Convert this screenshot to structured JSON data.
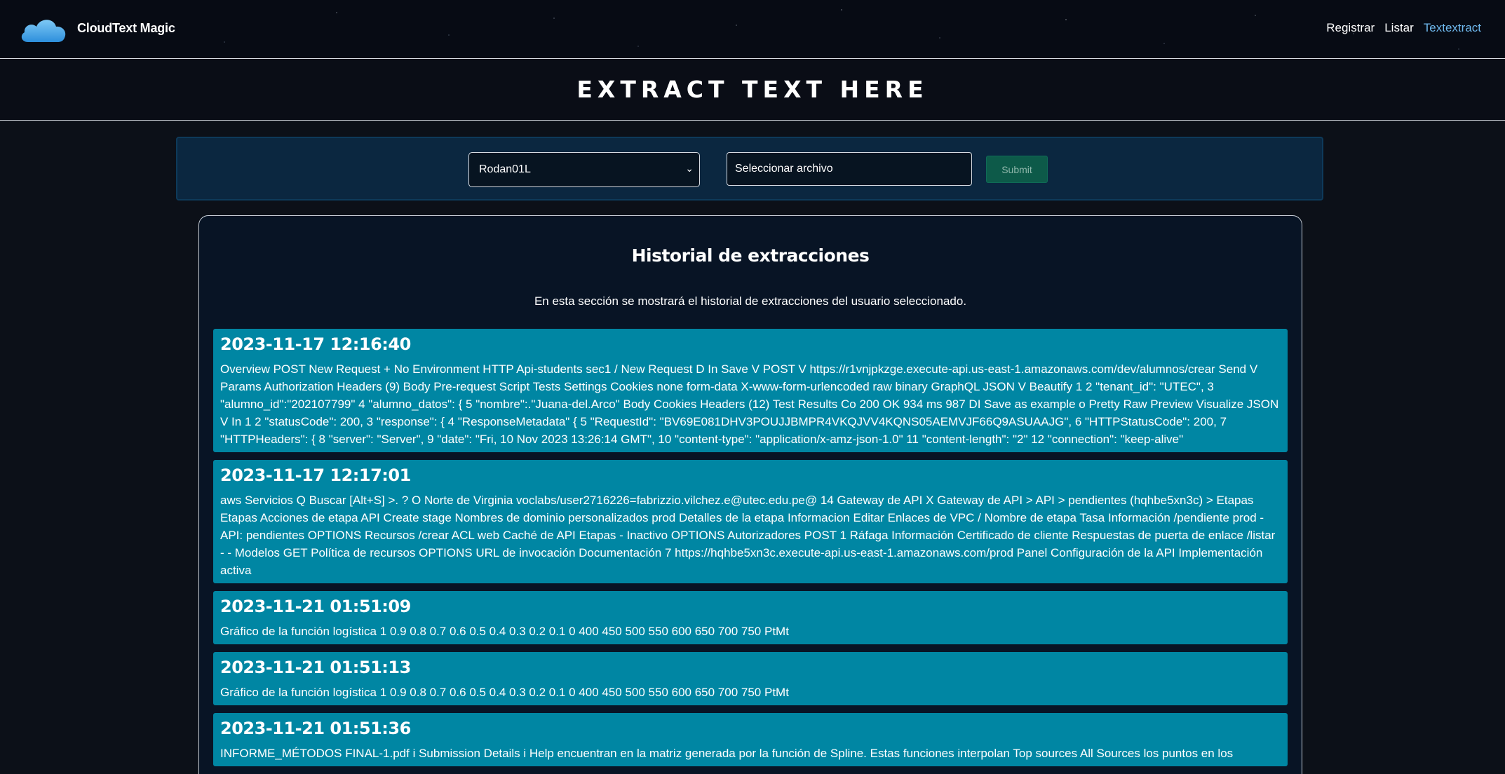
{
  "header": {
    "brand": "CloudText Magic",
    "nav": [
      {
        "label": "Registrar"
      },
      {
        "label": "Listar"
      },
      {
        "label": "Textextract"
      }
    ]
  },
  "banner": {
    "title": "EXTRACT TEXT HERE"
  },
  "form": {
    "user_select_value": "Rodan01L",
    "file_label": "Seleccionar archivo",
    "submit_label": "Submit"
  },
  "history": {
    "title": "Historial de extracciones",
    "description": "En esta sección se mostrará el historial de extracciones del usuario seleccionado.",
    "entries": [
      {
        "date": "2023-11-17 12:16:40",
        "text": "Overview POST New Request + No Environment HTTP Api-students sec1 / New Request D In Save V POST V https://r1vnjpkzge.execute-api.us-east-1.amazonaws.com/dev/alumnos/crear Send V Params Authorization Headers (9) Body Pre-request Script Tests Settings Cookies none form-data X-www-form-urlencoded raw binary GraphQL JSON V Beautify 1 2 \"tenant_id\": \"UTEC\", 3 \"alumno_id\":\"202107799\" 4 \"alumno_datos\": { 5 \"nombre\":.\"Juana-del.Arco\" Body Cookies Headers (12) Test Results Co 200 OK 934 ms 987 DI Save as example o Pretty Raw Preview Visualize JSON V In 1 2 \"statusCode\": 200, 3 \"response\": { 4 \"ResponseMetadata\" { 5 \"RequestId\": \"BV69E081DHV3POUJJBMPR4VKQJVV4KQNS05AEMVJF66Q9ASUAAJG\", 6 \"HTTPStatusCode\": 200, 7 \"HTTPHeaders\": { 8 \"server\": \"Server\", 9 \"date\": \"Fri, 10 Nov 2023 13:26:14 GMT\", 10 \"content-type\": \"application/x-amz-json-1.0\" 11 \"content-length\": \"2\" 12 \"connection\": \"keep-alive\""
      },
      {
        "date": "2023-11-17 12:17:01",
        "text": "aws Servicios Q Buscar [Alt+S] >. ? O Norte de Virginia voclabs/user2716226=fabrizzio.vilchez.e@utec.edu.pe@ 14 Gateway de API X Gateway de API > API > pendientes (hqhbe5xn3c) > Etapas Etapas Acciones de etapa API Create stage Nombres de dominio personalizados prod Detalles de la etapa Informacion Editar Enlaces de VPC / Nombre de etapa Tasa Información /pendiente prod - API: pendientes OPTIONS Recursos /crear ACL web Caché de API Etapas - Inactivo OPTIONS Autorizadores POST 1 Ráfaga Información Certificado de cliente Respuestas de puerta de enlace /listar - - Modelos GET Política de recursos OPTIONS URL de invocación Documentación 7 https://hqhbe5xn3c.execute-api.us-east-1.amazonaws.com/prod Panel Configuración de la API Implementación activa"
      },
      {
        "date": "2023-11-21 01:51:09",
        "text": "Gráfico de la función logística 1 0.9 0.8 0.7 0.6 0.5 0.4 0.3 0.2 0.1 0 400 450 500 550 600 650 700 750 PtMt"
      },
      {
        "date": "2023-11-21 01:51:13",
        "text": "Gráfico de la función logística 1 0.9 0.8 0.7 0.6 0.5 0.4 0.3 0.2 0.1 0 400 450 500 550 600 650 700 750 PtMt"
      },
      {
        "date": "2023-11-21 01:51:36",
        "text": "INFORME_MÉTODOS FINAL-1.pdf i Submission Details i Help encuentran en la matriz generada por la función de Spline. Estas funciones interpolan Top sources All Sources los puntos en los"
      }
    ]
  },
  "colors": {
    "accent_link": "#6fb9ee",
    "entry_bg": "#0086a3",
    "submit_bg": "#0d5a49"
  }
}
